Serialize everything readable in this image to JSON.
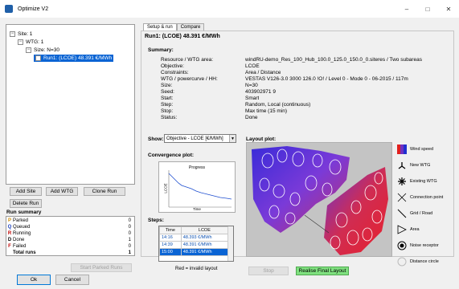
{
  "window": {
    "title": "Optimize V2",
    "min": "–",
    "max": "□",
    "close": "✕"
  },
  "tree": {
    "site": "Site: 1",
    "wtg": "WTG: 1",
    "size": "Size: N=30",
    "run": "Run1: (LCOE) 48.391 €/MWh"
  },
  "left_buttons": {
    "add_site": "Add Site",
    "add_wtg": "Add WTG",
    "clone_run": "Clone Run",
    "delete_run": "Delete Run"
  },
  "run_summary": {
    "label": "Run summary",
    "rows": [
      {
        "letter": "P",
        "name": "Parked",
        "count": "0",
        "color": "#cc8a00"
      },
      {
        "letter": "Q",
        "name": "Queued",
        "count": "0",
        "color": "#1a3fbf"
      },
      {
        "letter": "R",
        "name": "Running",
        "count": "0",
        "color": "#c00000"
      },
      {
        "letter": "D",
        "name": "Done",
        "count": "1",
        "color": "#000000"
      },
      {
        "letter": "F",
        "name": "Failed",
        "count": "0",
        "color": "#c00000"
      },
      {
        "letter": "",
        "name": "Total runs",
        "count": "1",
        "color": "#000000"
      }
    ]
  },
  "start_parked": "Start Parked Runs",
  "tabs": [
    "Setup & run",
    "Compare"
  ],
  "run_title": "Run1: (LCOE) 48.391 €/MWh",
  "summary": {
    "heading": "Summary:",
    "rows": [
      {
        "k": "Resource / WTG area:",
        "v": "windRU-demo_Res_100_Hub_100.0_125.0_150.0_0.siteres / Two subareas"
      },
      {
        "k": "Objective:",
        "v": "LCOE"
      },
      {
        "k": "Constraints:",
        "v": "Area / Distance"
      },
      {
        "k": "WTG / powercurve / HH:",
        "v": "VESTAS V126-3.0 3000 126.0 !O! / Level 0 - Mode 0 - 06-2015 / 117m"
      },
      {
        "k": "Size:",
        "v": "N=30"
      },
      {
        "k": "Seed:",
        "v": "403902971 9"
      },
      {
        "k": "Start:",
        "v": "Smart"
      },
      {
        "k": "Step:",
        "v": "Random, Local (continuous)"
      },
      {
        "k": "Stop:",
        "v": "Max time (15 min)"
      },
      {
        "k": "Status:",
        "v": "Done"
      }
    ]
  },
  "show": {
    "label": "Show:",
    "value": "Objective - LCOE [€/MWh]"
  },
  "convergence": {
    "heading": "Convergence plot:",
    "title": "Progress",
    "ylabel": "LCOE",
    "xlabel": "Time"
  },
  "steps": {
    "heading": "Steps:",
    "headers": [
      "Time",
      "LCOE"
    ],
    "rows": [
      {
        "time": "14:16",
        "lcoe": "48.393 €/MWh"
      },
      {
        "time": "14:39",
        "lcoe": "48.391 €/MWh"
      },
      {
        "time": "15:00",
        "lcoe": "48.391 €/MWh"
      }
    ]
  },
  "red_note": "Red = invalid layout",
  "layout_heading": "Layout plot:",
  "legend": [
    {
      "label": "Wind speed",
      "icon": "wind-speed-icon"
    },
    {
      "label": "New WTG",
      "icon": "new-wtg-icon"
    },
    {
      "label": "Existing WTG",
      "icon": "existing-wtg-icon"
    },
    {
      "label": "Connection point",
      "icon": "connection-point-icon"
    },
    {
      "label": "Grid / Road",
      "icon": "grid-road-icon"
    },
    {
      "label": "Area",
      "icon": "area-icon"
    },
    {
      "label": "Noise receptor",
      "icon": "noise-receptor-icon"
    },
    {
      "label": "Distance circle",
      "icon": "distance-circle-icon"
    }
  ],
  "bottom": {
    "stop": "Stop",
    "realise": "Realise Final Layout",
    "ok": "Ok",
    "cancel": "Cancel"
  }
}
